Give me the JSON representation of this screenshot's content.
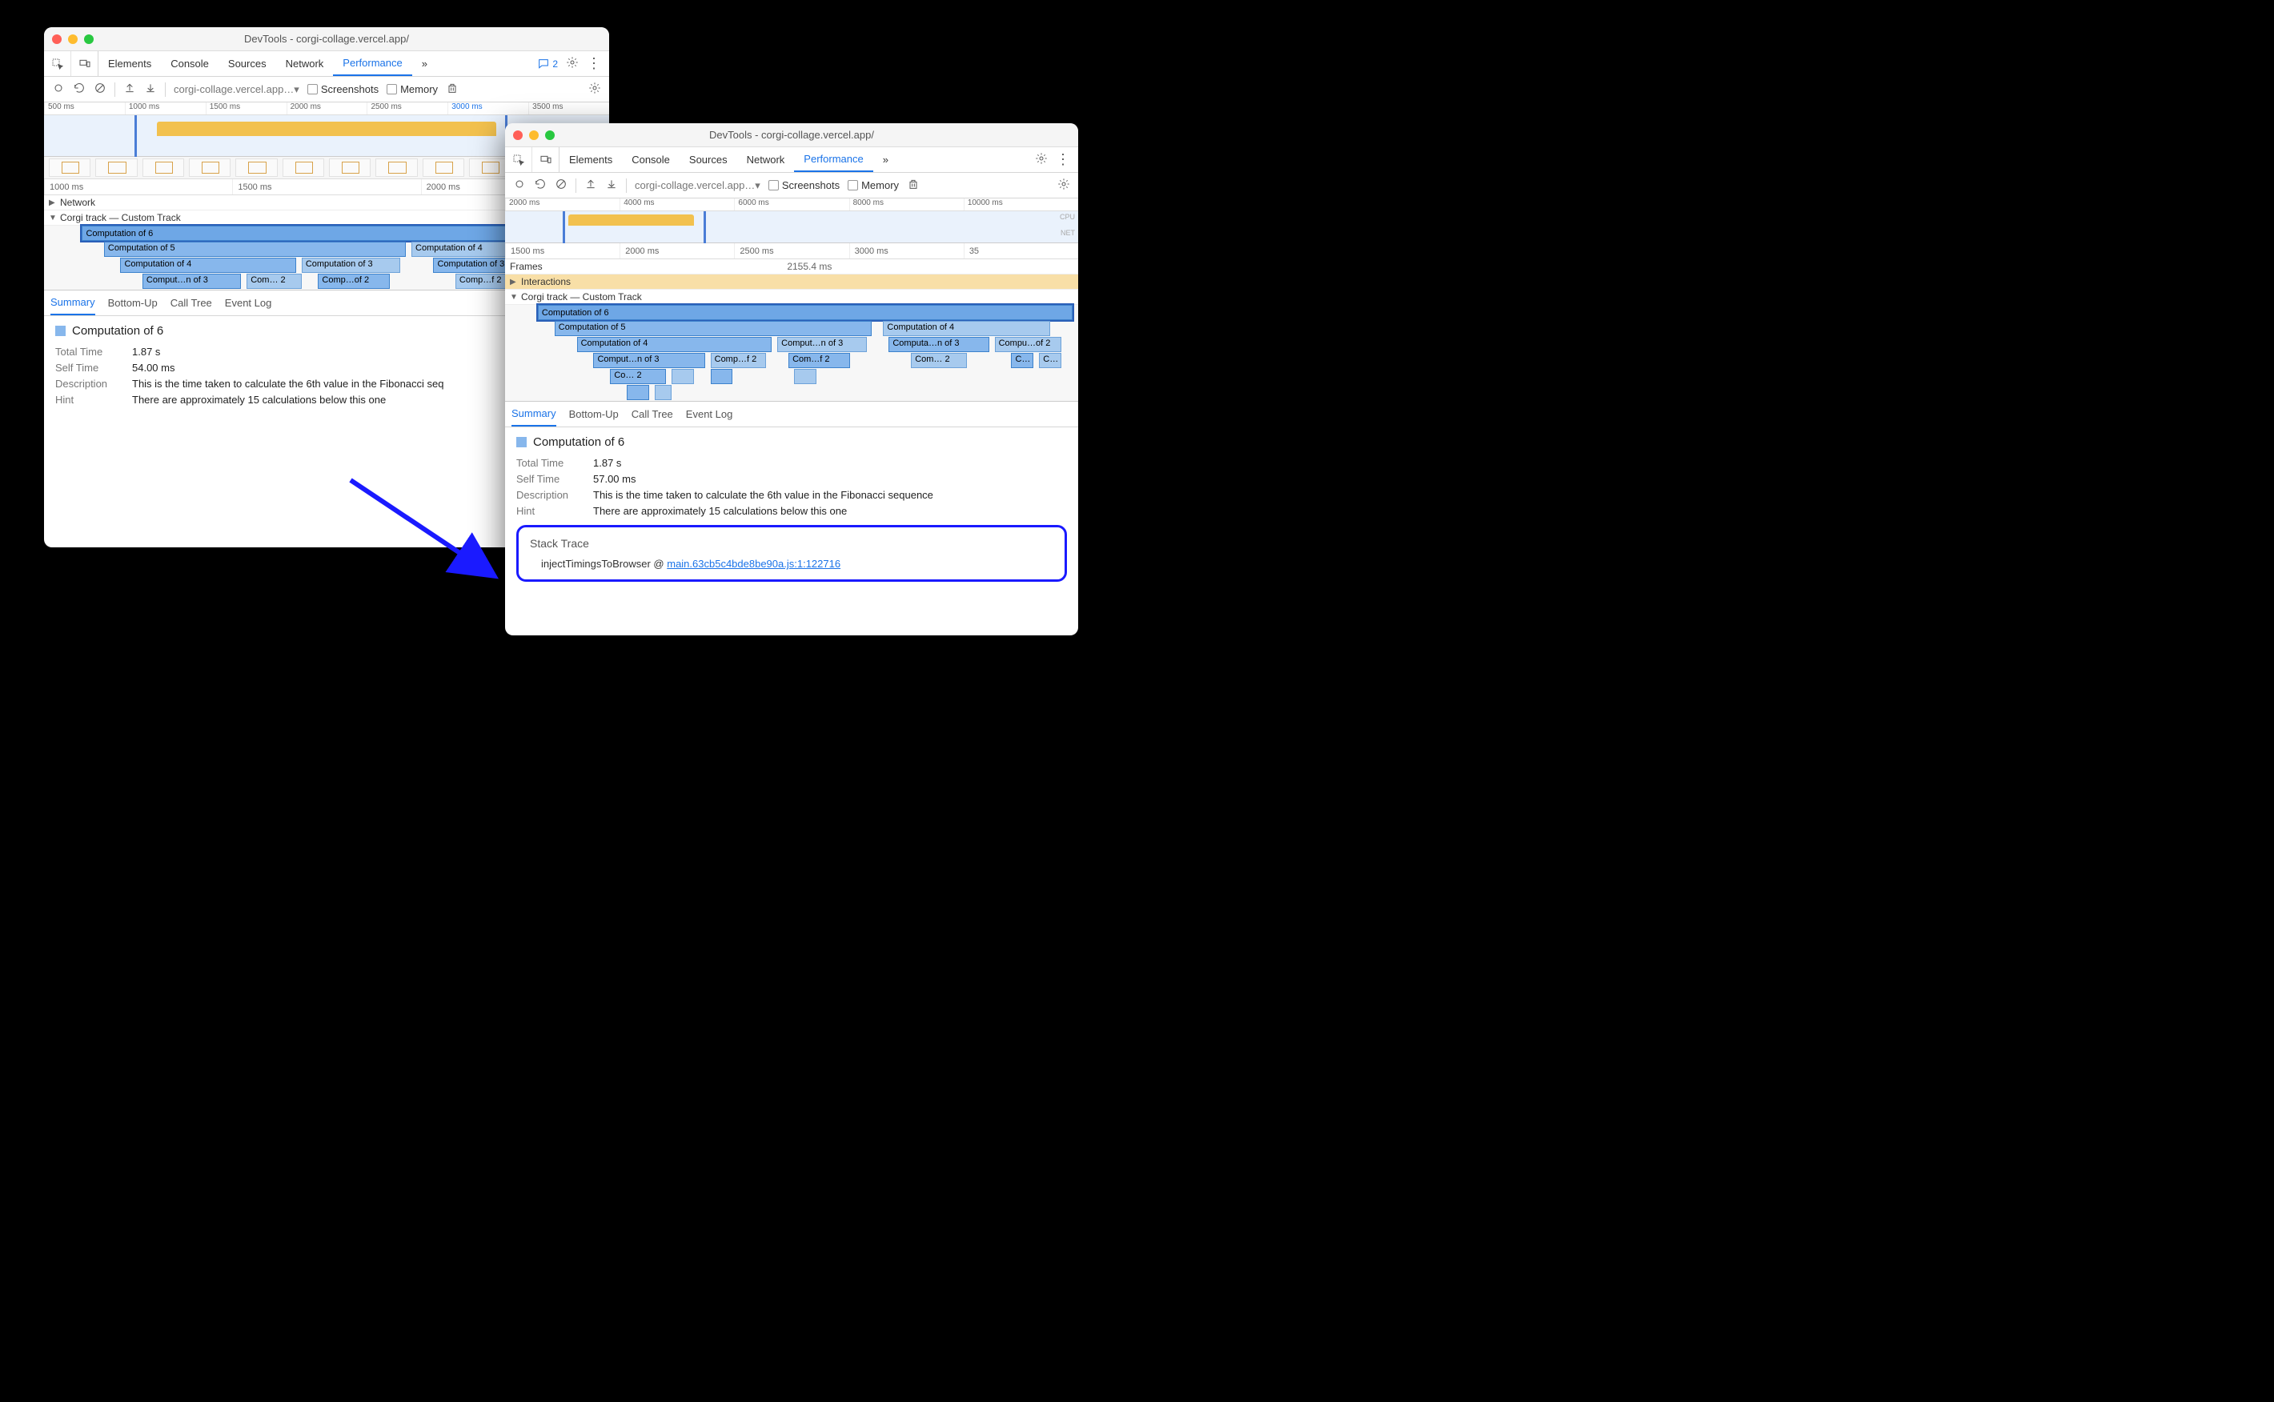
{
  "w1": {
    "title": "DevTools - corgi-collage.vercel.app/",
    "tabs": [
      "Elements",
      "Console",
      "Sources",
      "Network",
      "Performance"
    ],
    "active_tab": "Performance",
    "more_glyph": "»",
    "chat_count": "2",
    "url_selector": "corgi-collage.vercel.app…▾",
    "cb_screenshots": "Screenshots",
    "cb_memory": "Memory",
    "overview_ticks": [
      "500 ms",
      "1000 ms",
      "1500 ms",
      "2000 ms",
      "2500 ms",
      "3000 ms",
      "3500 ms"
    ],
    "ruler2": [
      "1000 ms",
      "1500 ms",
      "2000 ms"
    ],
    "track_network": "Network",
    "track_custom": "Corgi track — Custom Track",
    "flame": {
      "r0": [
        {
          "l": 4,
          "w": 96,
          "t": "Computation of 6",
          "cls": "sel"
        }
      ],
      "r1": [
        {
          "l": 8,
          "w": 55,
          "t": "Computation of 5"
        },
        {
          "l": 64,
          "w": 24,
          "t": "Computation of 4",
          "cls": "lt"
        }
      ],
      "r2": [
        {
          "l": 11,
          "w": 32,
          "t": "Computation of 4"
        },
        {
          "l": 44,
          "w": 18,
          "t": "Computation of 3",
          "cls": "lt"
        },
        {
          "l": 68,
          "w": 22,
          "t": "Computation of 3"
        }
      ],
      "r3": [
        {
          "l": 15,
          "w": 18,
          "t": "Comput…n of 3"
        },
        {
          "l": 34,
          "w": 10,
          "t": "Com… 2",
          "cls": "lt"
        },
        {
          "l": 47,
          "w": 13,
          "t": "Comp…of 2"
        },
        {
          "l": 72,
          "w": 12,
          "t": "Comp…f 2",
          "cls": "lt"
        }
      ]
    },
    "dtabs": [
      "Summary",
      "Bottom-Up",
      "Call Tree",
      "Event Log"
    ],
    "dtab_active": "Summary",
    "det_title": "Computation of 6",
    "total_k": "Total Time",
    "total_v": "1.87 s",
    "self_k": "Self Time",
    "self_v": "54.00 ms",
    "desc_k": "Description",
    "desc_v": "This is the time taken to calculate the 6th value in the Fibonacci seq",
    "hint_k": "Hint",
    "hint_v": "There are approximately 15 calculations below this one"
  },
  "w2": {
    "title": "DevTools - corgi-collage.vercel.app/",
    "tabs": [
      "Elements",
      "Console",
      "Sources",
      "Network",
      "Performance"
    ],
    "active_tab": "Performance",
    "more_glyph": "»",
    "url_selector": "corgi-collage.vercel.app…▾",
    "cb_screenshots": "Screenshots",
    "cb_memory": "Memory",
    "overview_ticks": [
      "2000 ms",
      "4000 ms",
      "6000 ms",
      "8000 ms",
      "10000 ms"
    ],
    "cpu_label": "CPU",
    "net_label": "NET",
    "ruler2": [
      "1500 ms",
      "2000 ms",
      "2500 ms",
      "3000 ms",
      "35"
    ],
    "frames_label": "Frames",
    "frames_value": "2155.4 ms",
    "track_interactions": "Interactions",
    "track_custom": "Corgi track — Custom Track",
    "flame": {
      "r0": [
        {
          "l": 3,
          "w": 96,
          "t": "Computation of 6",
          "cls": "sel"
        }
      ],
      "r1": [
        {
          "l": 6,
          "w": 57,
          "t": "Computation of 5"
        },
        {
          "l": 65,
          "w": 30,
          "t": "Computation of 4",
          "cls": "lt"
        }
      ],
      "r2": [
        {
          "l": 10,
          "w": 35,
          "t": "Computation of 4"
        },
        {
          "l": 46,
          "w": 16,
          "t": "Comput…n of 3",
          "cls": "lt"
        },
        {
          "l": 66,
          "w": 18,
          "t": "Computa…n of 3"
        },
        {
          "l": 85,
          "w": 12,
          "t": "Compu…of 2",
          "cls": "lt"
        }
      ],
      "r3": [
        {
          "l": 13,
          "w": 20,
          "t": "Comput…n of 3"
        },
        {
          "l": 34,
          "w": 10,
          "t": "Comp…f 2",
          "cls": "lt"
        },
        {
          "l": 48,
          "w": 11,
          "t": "Com…f 2"
        },
        {
          "l": 70,
          "w": 10,
          "t": "Com… 2",
          "cls": "lt"
        },
        {
          "l": 88,
          "w": 4,
          "t": "C…"
        },
        {
          "l": 93,
          "w": 4,
          "t": "C…",
          "cls": "lt"
        }
      ],
      "r4": [
        {
          "l": 16,
          "w": 10,
          "t": "Co… 2"
        },
        {
          "l": 27,
          "w": 4,
          "t": "",
          "cls": "lt"
        },
        {
          "l": 34,
          "w": 4,
          "t": ""
        },
        {
          "l": 49,
          "w": 4,
          "t": "",
          "cls": "lt"
        }
      ],
      "r5": [
        {
          "l": 19,
          "w": 4,
          "t": ""
        },
        {
          "l": 24,
          "w": 3,
          "t": "",
          "cls": "lt"
        }
      ]
    },
    "dtabs": [
      "Summary",
      "Bottom-Up",
      "Call Tree",
      "Event Log"
    ],
    "dtab_active": "Summary",
    "det_title": "Computation of 6",
    "total_k": "Total Time",
    "total_v": "1.87 s",
    "self_k": "Self Time",
    "self_v": "57.00 ms",
    "desc_k": "Description",
    "desc_v": "This is the time taken to calculate the 6th value in the Fibonacci sequence",
    "hint_k": "Hint",
    "hint_v": "There are approximately 15 calculations below this one",
    "stack_h": "Stack Trace",
    "stack_fn": "injectTimingsToBrowser",
    "stack_at": "@",
    "stack_link": "main.63cb5c4bde8be90a.js:1:122716"
  }
}
